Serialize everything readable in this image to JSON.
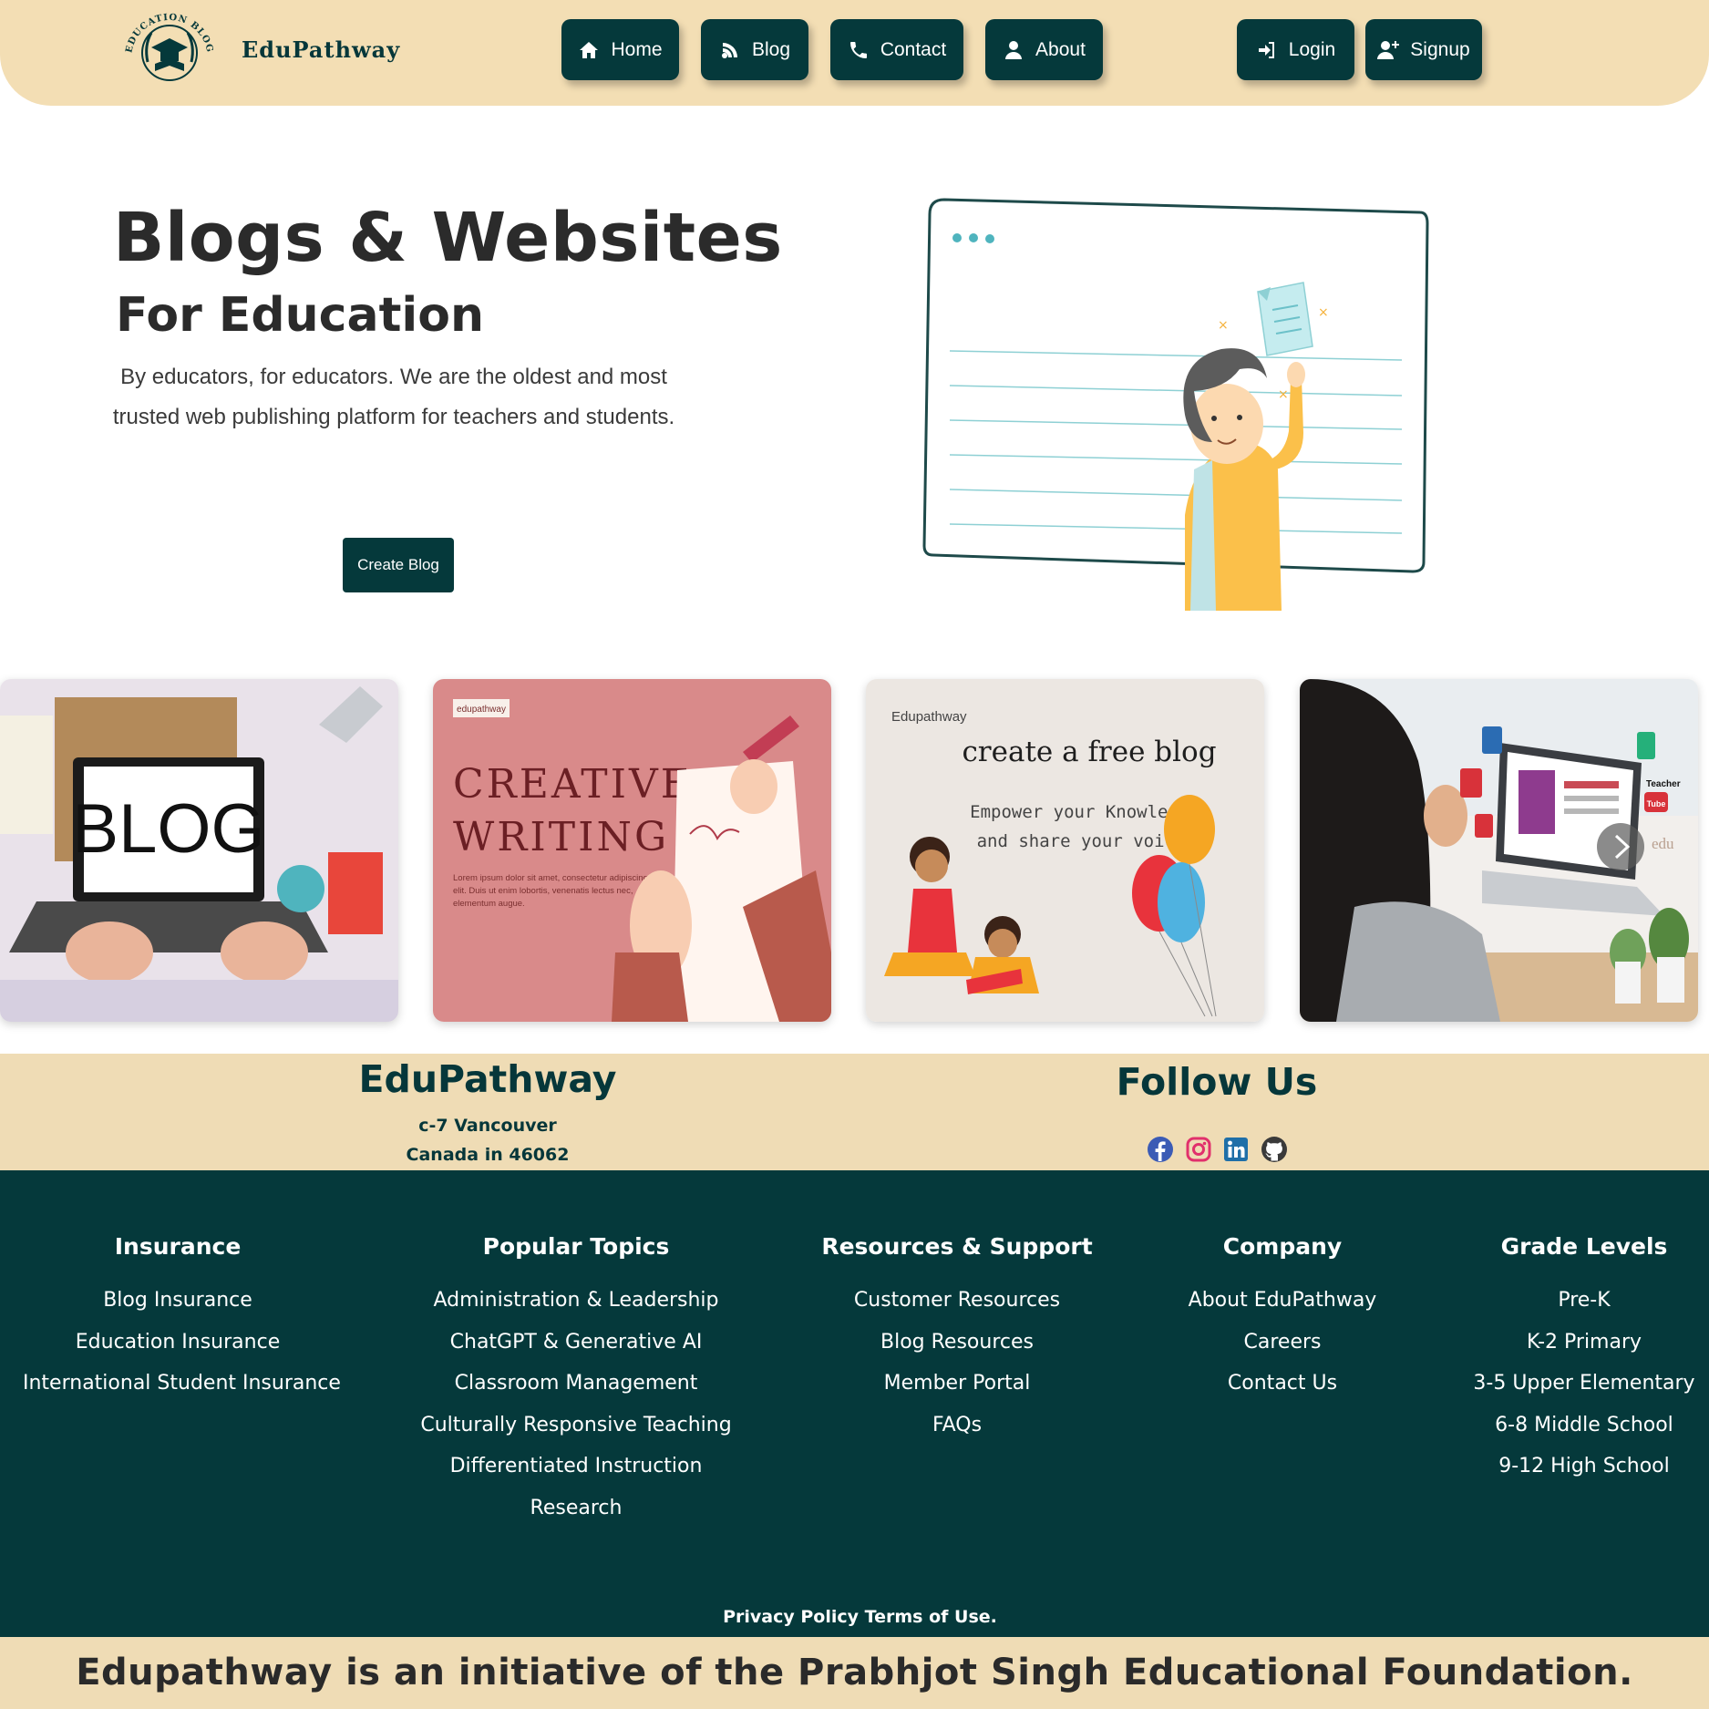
{
  "header": {
    "brand": "EduPathway",
    "logo_text": "EDUCATION BLOG",
    "nav": [
      {
        "label": "Home",
        "icon": "home-icon"
      },
      {
        "label": "Blog",
        "icon": "blog-icon"
      },
      {
        "label": "Contact",
        "icon": "phone-icon"
      },
      {
        "label": "About",
        "icon": "user-icon"
      }
    ],
    "auth": [
      {
        "label": "Login",
        "icon": "login-icon"
      },
      {
        "label": "Signup",
        "icon": "user-plus-icon"
      }
    ]
  },
  "hero": {
    "title": "Blogs & Websites",
    "subtitle": "For Education",
    "description": "By educators, for educators. We are the oldest and most trusted web publishing platform for teachers and students.",
    "cta_label": "Create Blog"
  },
  "cards": [
    {
      "alt": "Laptop showing BLOG on a desk with stationery",
      "screen_text": "BLOG"
    },
    {
      "tag": "edupathway",
      "title_line1": "CREATIVE",
      "title_line2": "WRITING",
      "body": "Lorem ipsum dolor sit amet, consectetur adipiscing elit. Duis ut enim lobortis, venenatis lectus nec, elementum augue."
    },
    {
      "tag": "Edupathway",
      "title": "create a free blog",
      "tagline_line1": "Empower your Knowledge",
      "tagline_line2": "and share your voice"
    },
    {
      "alt": "Child studying at laptop with education app icons",
      "badges": [
        "Teacher",
        "Tube",
        "edu"
      ]
    }
  ],
  "info": {
    "brand": "EduPathway",
    "address_line1": "c-7 Vancouver",
    "address_line2": "Canada in 46062",
    "follow_title": "Follow Us",
    "social": [
      "facebook-icon",
      "instagram-icon",
      "linkedin-icon",
      "github-icon"
    ]
  },
  "footer": {
    "columns": [
      {
        "title": "Insurance",
        "links": [
          "Blog Insurance",
          "Education Insurance",
          "International Student Insurance"
        ]
      },
      {
        "title": "Popular Topics",
        "links": [
          "Administration & Leadership",
          "ChatGPT & Generative AI",
          "Classroom Management",
          "Culturally Responsive Teaching",
          "Differentiated Instruction",
          "Research"
        ]
      },
      {
        "title": "Resources & Support",
        "links": [
          "Customer Resources",
          "Blog Resources",
          "Member Portal",
          "FAQs"
        ]
      },
      {
        "title": "Company",
        "links": [
          "About EduPathway",
          "Careers",
          "Contact Us"
        ]
      },
      {
        "title": "Grade Levels",
        "links": [
          "Pre-K",
          "K-2 Primary",
          "3-5 Upper Elementary",
          "6-8 Middle School",
          "9-12 High School"
        ]
      }
    ],
    "privacy": "Privacy Policy",
    "terms": "Terms of Use."
  },
  "bottom_text": "Edupathway is an initiative of the Prabhjot Singh Educational Foundation.",
  "colors": {
    "primary": "#05393b",
    "cream": "#f3deb4",
    "band": "#efdcb5"
  }
}
